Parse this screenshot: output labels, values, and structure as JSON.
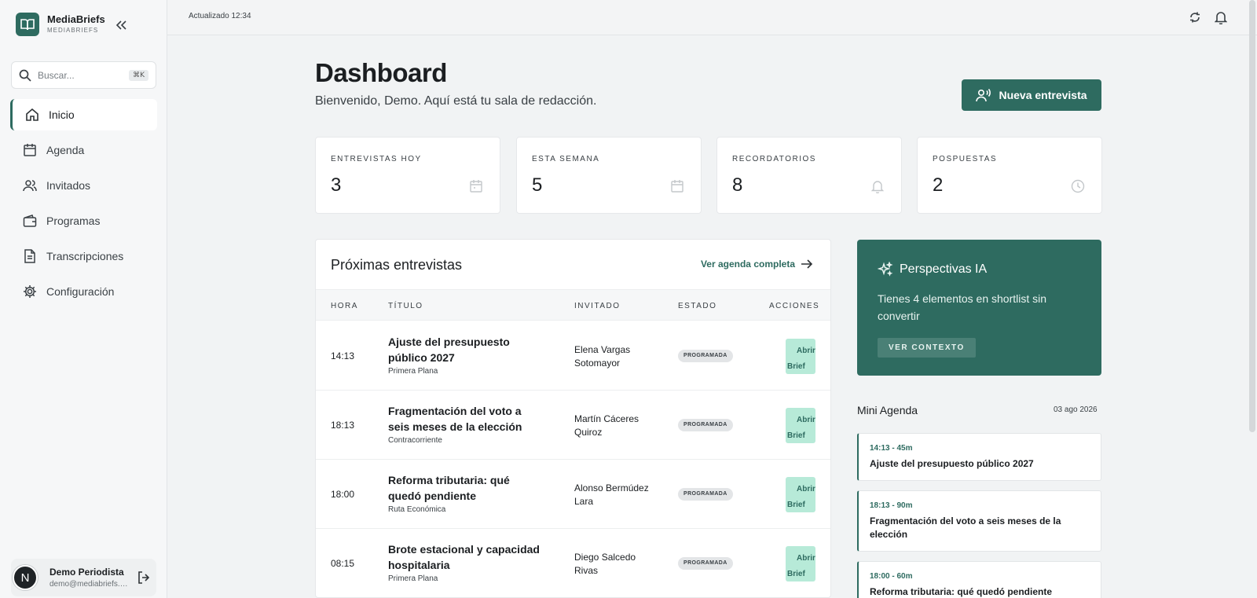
{
  "brand": {
    "name": "MediaBriefs",
    "sub": "MEDIABRIEFS"
  },
  "search": {
    "placeholder": "Buscar...",
    "shortcut": "⌘K"
  },
  "nav": [
    {
      "label": "Inicio",
      "icon": "home-icon"
    },
    {
      "label": "Agenda",
      "icon": "calendar-icon"
    },
    {
      "label": "Invitados",
      "icon": "users-icon"
    },
    {
      "label": "Programas",
      "icon": "wallet-icon"
    },
    {
      "label": "Transcripciones",
      "icon": "document-icon"
    },
    {
      "label": "Configuración",
      "icon": "gear-icon"
    }
  ],
  "user": {
    "initial": "N",
    "name": "Demo Periodista",
    "email": "demo@mediabriefs.com"
  },
  "topbar": {
    "updated": "Actualizado 12:34"
  },
  "page": {
    "title": "Dashboard",
    "subtitle": "Bienvenido, Demo. Aquí está tu sala de redacción.",
    "new_button": "Nueva entrevista"
  },
  "stats": [
    {
      "label": "ENTREVISTAS HOY",
      "value": "3",
      "icon": "calendar-icon"
    },
    {
      "label": "ESTA SEMANA",
      "value": "5",
      "icon": "calendar-icon"
    },
    {
      "label": "RECORDATORIOS",
      "value": "8",
      "icon": "bell-icon"
    },
    {
      "label": "POSPUESTAS",
      "value": "2",
      "icon": "clock-icon"
    }
  ],
  "upcoming": {
    "title": "Próximas entrevistas",
    "link": "Ver agenda completa",
    "columns": [
      "HORA",
      "TÍTULO",
      "INVITADO",
      "ESTADO",
      "ACCIONES"
    ],
    "rows": [
      {
        "time": "14:13",
        "title": "Ajuste del presupuesto público 2027",
        "program": "Primera Plana",
        "guest": "Elena Vargas Sotomayor",
        "status": "PROGRAMADA",
        "action1": "Abrir",
        "action2": "Brief"
      },
      {
        "time": "18:13",
        "title": "Fragmentación del voto a seis meses de la elección",
        "program": "Contracorriente",
        "guest": "Martín Cáceres Quiroz",
        "status": "PROGRAMADA",
        "action1": "Abrir",
        "action2": "Brief"
      },
      {
        "time": "18:00",
        "title": "Reforma tributaria: qué quedó pendiente",
        "program": "Ruta Económica",
        "guest": "Alonso Bermúdez Lara",
        "status": "PROGRAMADA",
        "action1": "Abrir",
        "action2": "Brief"
      },
      {
        "time": "08:15",
        "title": "Brote estacional y capacidad hospitalaria",
        "program": "Primera Plana",
        "guest": "Diego Salcedo Rivas",
        "status": "PROGRAMADA",
        "action1": "Abrir",
        "action2": "Brief"
      }
    ]
  },
  "ai": {
    "title": "Perspectivas IA",
    "text": "Tienes 4 elementos en shortlist sin convertir",
    "button": "VER CONTEXTO"
  },
  "mini_agenda": {
    "title": "Mini Agenda",
    "date": "03 ago 2026",
    "items": [
      {
        "time": "14:13 - 45m",
        "title": "Ajuste del presupuesto público 2027"
      },
      {
        "time": "18:13 - 90m",
        "title": "Fragmentación del voto a seis meses de la elección"
      },
      {
        "time": "18:00 - 60m",
        "title": "Reforma tributaria: qué quedó pendiente"
      }
    ]
  },
  "colors": {
    "accent": "#2e6b60",
    "accent_light": "#b7ead8",
    "background": "#f1f3f4"
  }
}
